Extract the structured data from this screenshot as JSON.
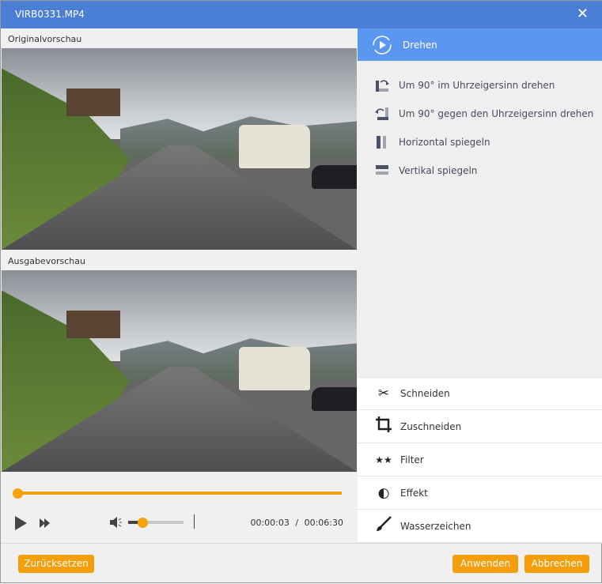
{
  "window": {
    "title": "VIRB0331.MP4",
    "close": "✕"
  },
  "preview": {
    "original_label": "Originalvorschau",
    "output_label": "Ausgabevorschau"
  },
  "player": {
    "progress": 0.0,
    "volume": 0.27,
    "current_time": "00:00:03",
    "separator": "/",
    "total_time": "00:06:30"
  },
  "rotate_panel": {
    "title": "Drehen",
    "options": [
      {
        "label": "Um 90° im Uhrzeigersinn drehen"
      },
      {
        "label": "Um 90° gegen den Uhrzeigersinn drehen"
      },
      {
        "label": "Horizontal spiegeln"
      },
      {
        "label": "Vertikal spiegeln"
      }
    ]
  },
  "tools": [
    {
      "label": "Schneiden"
    },
    {
      "label": "Zuschneiden"
    },
    {
      "label": "Filter"
    },
    {
      "label": "Effekt"
    },
    {
      "label": "Wasserzeichen"
    }
  ],
  "footer": {
    "reset": "Zurücksetzen",
    "apply": "Anwenden",
    "cancel": "Abbrechen"
  },
  "colors": {
    "accent": "#f59e0b",
    "title_bar": "#4a7fd5",
    "panel_header": "#5b96f0"
  }
}
